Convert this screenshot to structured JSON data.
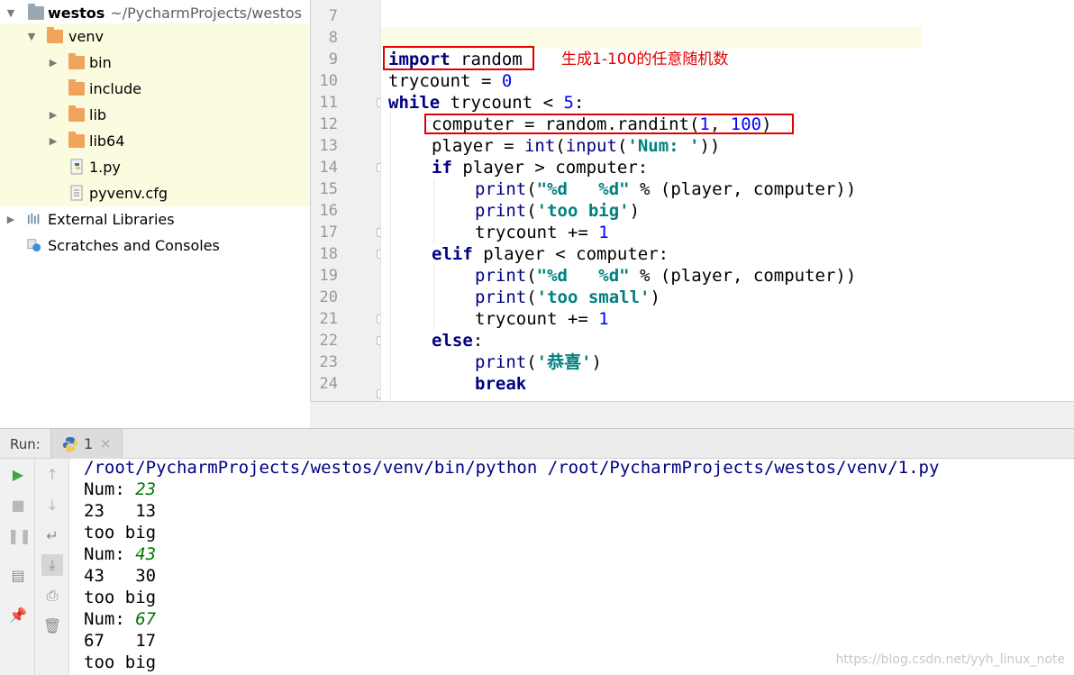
{
  "project_tree": {
    "root": {
      "label": "westos",
      "path": "~/PycharmProjects/westos"
    },
    "venv": "venv",
    "bin": "bin",
    "include": "include",
    "lib": "lib",
    "lib64": "lib64",
    "file_py": "1.py",
    "file_cfg": "pyvenv.cfg",
    "external_libraries": "External Libraries",
    "scratches": "Scratches and Consoles"
  },
  "editor": {
    "line_numbers": [
      "7",
      "8",
      "9",
      "10",
      "11",
      "12",
      "13",
      "14",
      "15",
      "16",
      "17",
      "18",
      "19",
      "20",
      "21",
      "22",
      "23",
      "24"
    ],
    "annotation": "生成1-100的任意随机数",
    "code": {
      "l9_kw": "import",
      "l9_rest": " random",
      "l10_a": "trycount = ",
      "l10_b": "0",
      "l11_kw": "while",
      "l11_a": " trycount < ",
      "l11_b": "5",
      "l11_c": ":",
      "l12_a": "computer = random.randint(",
      "l12_b": "1",
      "l12_c": ", ",
      "l12_d": "100",
      "l12_e": ")",
      "l13_a": "player = ",
      "l13_b": "int",
      "l13_c": "(",
      "l13_d": "input",
      "l13_e": "(",
      "l13_f": "'Num: '",
      "l13_g": "))",
      "l14_kw": "if",
      "l14_a": " player > computer:",
      "l15_a": "print",
      "l15_b": "(",
      "l15_c": "\"%d   %d\"",
      "l15_d": " % (player, computer))",
      "l16_a": "print",
      "l16_b": "(",
      "l16_c": "'too big'",
      "l16_d": ")",
      "l17_a": "trycount += ",
      "l17_b": "1",
      "l18_kw": "elif",
      "l18_a": " player < computer:",
      "l19_a": "print",
      "l19_b": "(",
      "l19_c": "\"%d   %d\"",
      "l19_d": " % (player, computer))",
      "l20_a": "print",
      "l20_b": "(",
      "l20_c": "'too small'",
      "l20_d": ")",
      "l21_a": "trycount += ",
      "l21_b": "1",
      "l22_kw": "else",
      "l22_a": ":",
      "l23_a": "print",
      "l23_b": "(",
      "l23_c": "'恭喜'",
      "l23_d": ")",
      "l24_kw": "break"
    }
  },
  "run_panel": {
    "label": "Run:",
    "tab_name": "1",
    "tab_close": "×",
    "console": {
      "command": "/root/PycharmProjects/westos/venv/bin/python /root/PycharmProjects/westos/venv/1.py",
      "lines": [
        {
          "prompt": "Num: ",
          "input": "23"
        },
        {
          "text": "23   13"
        },
        {
          "text": "too big"
        },
        {
          "prompt": "Num: ",
          "input": "43"
        },
        {
          "text": "43   30"
        },
        {
          "text": "too big"
        },
        {
          "prompt": "Num: ",
          "input": "67"
        },
        {
          "text": "67   17"
        },
        {
          "text": "too big"
        }
      ]
    }
  },
  "watermark": "https://blog.csdn.net/yyh_linux_note",
  "colors": {
    "keyword": "#000080",
    "number": "#0000ff",
    "string": "#008080",
    "highlight_box": "#e00000",
    "user_input": "#007a00"
  }
}
